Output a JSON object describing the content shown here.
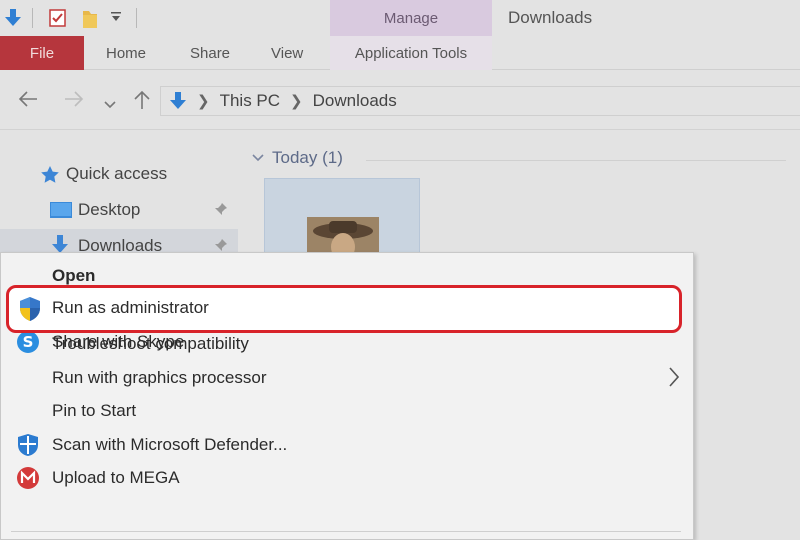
{
  "ribbon": {
    "manage_label": "Manage",
    "window_title": "Downloads",
    "tabs": {
      "file": "File",
      "home": "Home",
      "share": "Share",
      "view": "View",
      "app_tools": "Application Tools"
    }
  },
  "address": {
    "path": [
      "This PC",
      "Downloads"
    ]
  },
  "sidebar": {
    "items": [
      {
        "label": "Quick access",
        "icon": "star-icon"
      },
      {
        "label": "Desktop",
        "icon": "desktop-icon"
      },
      {
        "label": "Downloads",
        "icon": "downloads-icon"
      }
    ]
  },
  "content": {
    "group_label": "Today (1)"
  },
  "context_menu": {
    "items": [
      {
        "label": "Open",
        "icon": ""
      },
      {
        "label": "Run as administrator",
        "icon": "uac-shield-icon"
      },
      {
        "label": "Share with Skype",
        "icon": "skype-icon"
      },
      {
        "label": "Troubleshoot compatibility",
        "icon": ""
      },
      {
        "label": "Run with graphics processor",
        "icon": "",
        "submenu": true
      },
      {
        "label": "Pin to Start",
        "icon": ""
      },
      {
        "label": "Scan with Microsoft Defender...",
        "icon": "defender-icon"
      },
      {
        "label": "Upload to MEGA",
        "icon": "mega-icon"
      }
    ]
  },
  "colors": {
    "file_tab": "#b6363d",
    "manage_tab": "#d9cadf",
    "highlight_border": "#d8232a",
    "accent_blue": "#2f7fd3"
  }
}
